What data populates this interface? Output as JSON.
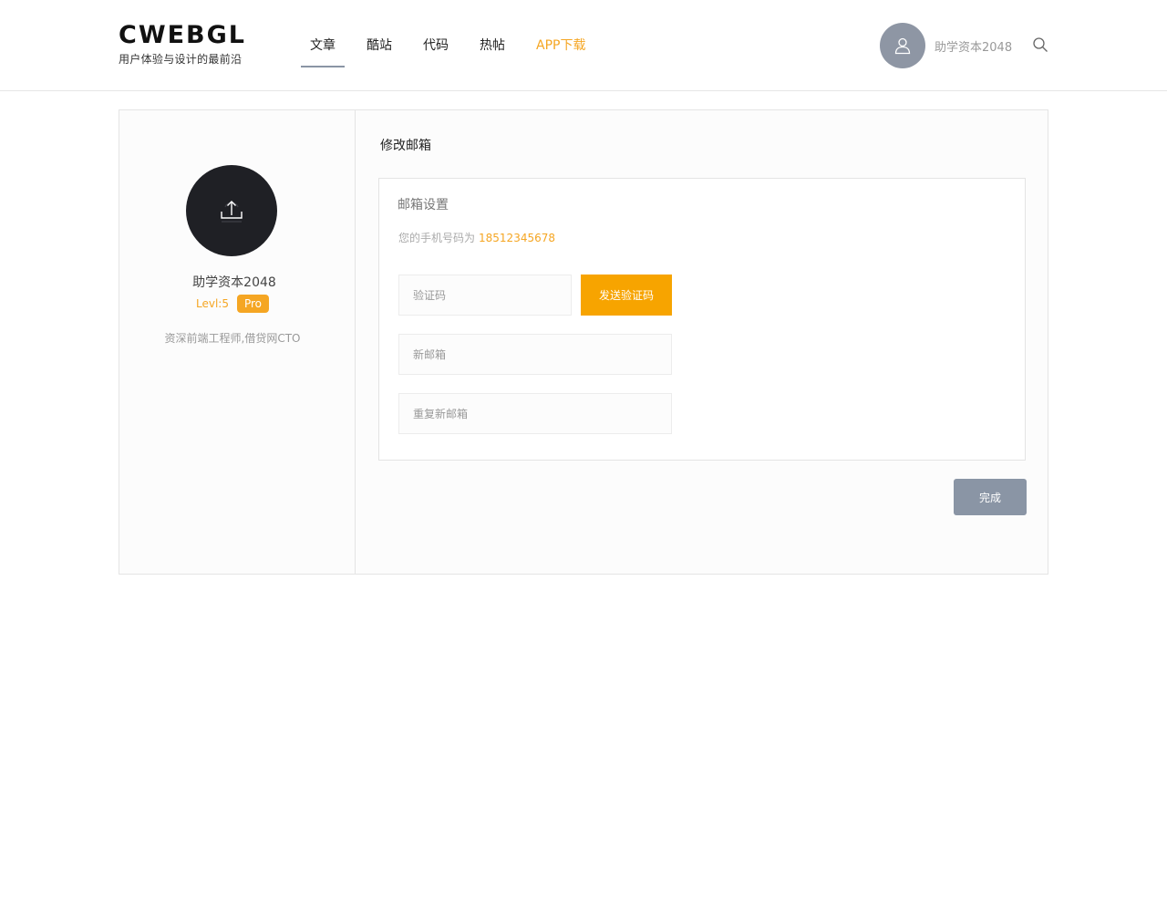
{
  "header": {
    "logo_title": "CWEBGL",
    "logo_subtitle": "用户体验与设计的最前沿",
    "nav": [
      {
        "label": "文章",
        "active": true
      },
      {
        "label": "酷站",
        "active": false
      },
      {
        "label": "代码",
        "active": false
      },
      {
        "label": "热帖",
        "active": false
      },
      {
        "label": "APP下载",
        "active": false
      }
    ],
    "user_name": "助学资本2048",
    "icons": {
      "avatar": "user-icon",
      "search": "search-icon"
    }
  },
  "profile": {
    "avatar_icon": "upload-icon",
    "name": "助学资本2048",
    "level": "Levl:5",
    "badge": "Pro",
    "description": "资深前端工程师,借贷网CTO"
  },
  "content": {
    "title": "修改邮箱",
    "panel_title": "邮箱设置",
    "phone_prefix": "您的手机号码为",
    "phone_number": "18512345678",
    "code_placeholder": "验证码",
    "send_code_label": "发送验证码",
    "new_email_placeholder": "新邮箱",
    "repeat_email_placeholder": "重复新邮箱",
    "done_label": "完成"
  },
  "colors": {
    "accent": "#f5a623",
    "send_button": "#f7a400",
    "muted_button": "#8a95a5",
    "avatar_dark": "#1f2025",
    "border": "#e4e4e4"
  }
}
